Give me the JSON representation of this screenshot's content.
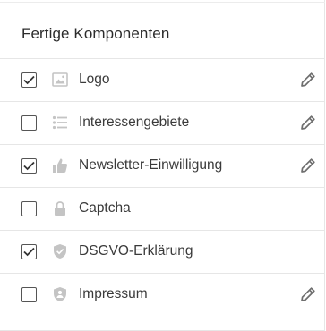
{
  "panel": {
    "title": "Fertige Komponenten"
  },
  "components": [
    {
      "label": "Logo",
      "checked": true,
      "icon": "image-icon",
      "editable": true
    },
    {
      "label": "Interessengebiete",
      "checked": false,
      "icon": "list-icon",
      "editable": true
    },
    {
      "label": "Newsletter-Einwilligung",
      "checked": true,
      "icon": "thumbs-up-icon",
      "editable": true
    },
    {
      "label": "Captcha",
      "checked": false,
      "icon": "lock-icon",
      "editable": false
    },
    {
      "label": "DSGVO-Erklärung",
      "checked": true,
      "icon": "shield-check-icon",
      "editable": false
    },
    {
      "label": "Impressum",
      "checked": false,
      "icon": "shield-person-icon",
      "editable": true
    }
  ],
  "colors": {
    "icon_gray": "#c4c4c4",
    "edit_gray": "#6e6e6e",
    "check_dark": "#333333"
  }
}
